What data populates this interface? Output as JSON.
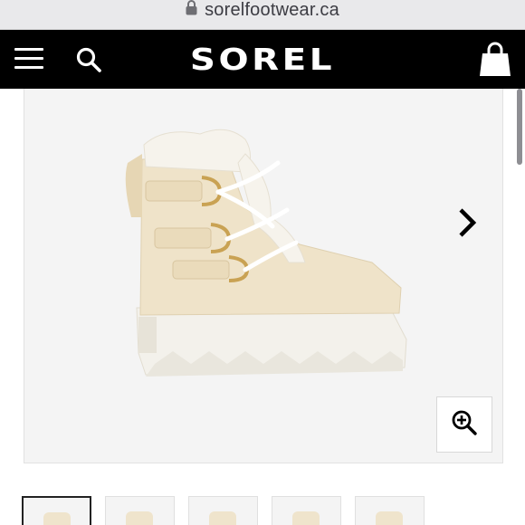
{
  "browser": {
    "url": "sorelfootwear.ca",
    "icon": "lock-icon"
  },
  "header": {
    "brand": "SOREL",
    "menu_icon": "hamburger-menu-icon",
    "search_icon": "search-icon",
    "cart_icon": "shopping-bag-icon"
  },
  "product": {
    "image_subject": "product-image",
    "next_icon": "chevron-right-icon",
    "zoom_icon": "zoom-in-icon"
  },
  "thumbnails": {
    "count": 5,
    "selected_index": 0
  },
  "colors": {
    "header_bg": "#000000",
    "panel_bg": "#f4f4f4",
    "boot_body": "#efe3c9",
    "sole": "#f2f0ea"
  }
}
